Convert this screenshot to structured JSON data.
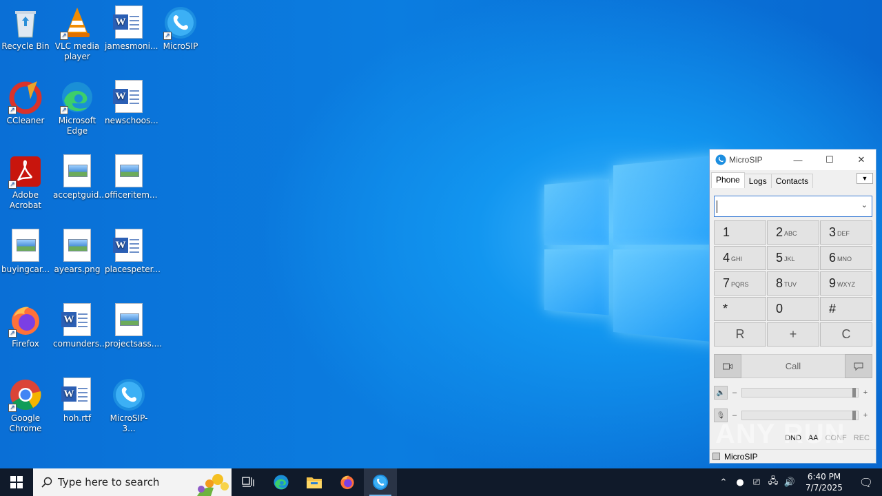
{
  "desktop": {
    "icons": [
      {
        "label": "Recycle Bin"
      },
      {
        "label": "VLC media player"
      },
      {
        "label": "jamesmoni..."
      },
      {
        "label": "MicroSIP"
      },
      {
        "label": "CCleaner"
      },
      {
        "label": "Microsoft Edge"
      },
      {
        "label": "newschoos..."
      },
      {
        "label": "Adobe Acrobat"
      },
      {
        "label": "acceptguid..."
      },
      {
        "label": "officeritem..."
      },
      {
        "label": "buyingcar..."
      },
      {
        "label": "ayears.png"
      },
      {
        "label": "placespeter..."
      },
      {
        "label": "Firefox"
      },
      {
        "label": "comunders..."
      },
      {
        "label": "projectsass...."
      },
      {
        "label": "Google Chrome"
      },
      {
        "label": "hoh.rtf"
      },
      {
        "label": "MicroSIP-3..."
      }
    ]
  },
  "microsip": {
    "title": "MicroSIP",
    "tabs": [
      "Phone",
      "Logs",
      "Contacts"
    ],
    "dial_value": "",
    "keys": [
      {
        "n": "1",
        "s": ""
      },
      {
        "n": "2",
        "s": "ABC"
      },
      {
        "n": "3",
        "s": "DEF"
      },
      {
        "n": "4",
        "s": "GHI"
      },
      {
        "n": "5",
        "s": "JKL"
      },
      {
        "n": "6",
        "s": "MNO"
      },
      {
        "n": "7",
        "s": "PQRS"
      },
      {
        "n": "8",
        "s": "TUV"
      },
      {
        "n": "9",
        "s": "WXYZ"
      },
      {
        "n": "*",
        "s": ""
      },
      {
        "n": "0",
        "s": ""
      },
      {
        "n": "#",
        "s": ""
      }
    ],
    "func_keys": [
      "R",
      "+",
      "C"
    ],
    "call_label": "Call",
    "minus": "–",
    "plus": "+",
    "speaker_level": 0.98,
    "mic_level": 0.98,
    "flags": [
      "DND",
      "AA",
      "CONF",
      "REC"
    ],
    "status": "MicroSIP"
  },
  "taskbar": {
    "search_placeholder": "Type here to search",
    "time": "6:40 PM",
    "date": "7/7/2025"
  },
  "watermark": "ANY RUN"
}
